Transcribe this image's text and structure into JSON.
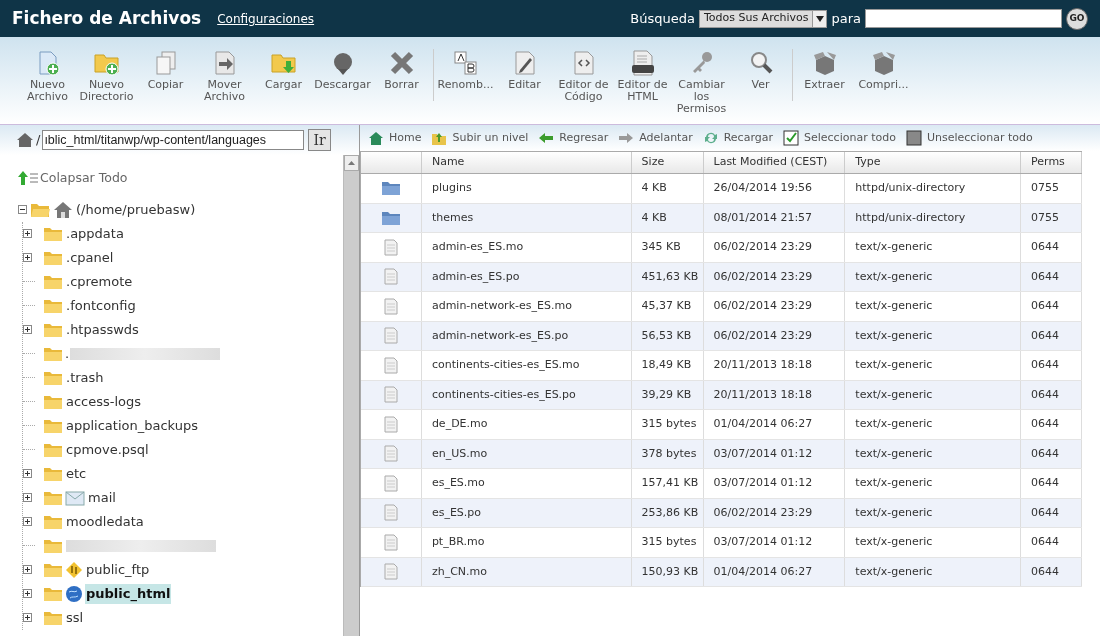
{
  "header": {
    "title": "Fichero de Archivos",
    "settings_link": "Configuraciones",
    "search_label": "Búsqueda",
    "search_scope": "Todos Sus Archivos",
    "for_label": "para",
    "go": "GO"
  },
  "toolbar": [
    [
      "Nuevo Archivo",
      "Nuevo Directorio",
      "Copiar",
      "Mover Archivo",
      "Cargar",
      "Descargar",
      "Borrar"
    ],
    [
      "Renomb...",
      "Editar",
      "Editor de Código",
      "Editor de HTML",
      "Cambiar los Permisos",
      "Ver"
    ],
    [
      "Extraer",
      "Compri..."
    ]
  ],
  "path": {
    "value": "ıblic_html/titanwp/wp-content/languages",
    "prefix": "/",
    "button": "Ir"
  },
  "collapse_all": "Colapsar Todo",
  "tree": {
    "label": "(/home/pruebasw)",
    "expanded": true,
    "children": [
      {
        "label": ".appdata",
        "kind": "folder",
        "expandable": true,
        "selected": false
      },
      {
        "label": ".cpanel",
        "kind": "folder",
        "expandable": true,
        "selected": false
      },
      {
        "label": ".cpremote",
        "kind": "folder",
        "expandable": false,
        "selected": false
      },
      {
        "label": ".fontconfig",
        "kind": "folder",
        "expandable": false,
        "selected": false
      },
      {
        "label": ".htpasswds",
        "kind": "folder",
        "expandable": true,
        "selected": false
      },
      {
        "label": ".",
        "kind": "blurred",
        "expandable": false,
        "selected": false
      },
      {
        "label": ".trash",
        "kind": "folder",
        "expandable": false,
        "selected": false
      },
      {
        "label": "access-logs",
        "kind": "folder",
        "expandable": false,
        "selected": false
      },
      {
        "label": "application_backups",
        "kind": "folder",
        "expandable": false,
        "selected": false
      },
      {
        "label": "cpmove.psql",
        "kind": "folder",
        "expandable": false,
        "selected": false
      },
      {
        "label": "etc",
        "kind": "folder",
        "expandable": true,
        "selected": false
      },
      {
        "label": "mail",
        "kind": "mail",
        "expandable": true,
        "selected": false
      },
      {
        "label": "moodledata",
        "kind": "folder",
        "expandable": true,
        "selected": false
      },
      {
        "kind": "blurred",
        "expandable": false,
        "selected": false
      },
      {
        "label": "public_ftp",
        "kind": "ftp",
        "expandable": true,
        "selected": false
      },
      {
        "label": "public_html",
        "kind": "web",
        "expandable": true,
        "selected": true
      },
      {
        "label": "ssl",
        "kind": "folder",
        "expandable": true,
        "selected": false
      }
    ]
  },
  "actions": [
    "Home",
    "Subir un nivel",
    "Regresar",
    "Adelantar",
    "Recargar",
    "Seleccionar todo",
    "Unseleccionar todo"
  ],
  "table": {
    "columns": [
      "Name",
      "Size",
      "Last Modified (CEST)",
      "Type",
      "Perms"
    ],
    "rows": [
      {
        "kind": "folder",
        "cells": [
          "plugins",
          "4 KB",
          "26/04/2014 19:56",
          "httpd/unix-directory",
          "0755"
        ]
      },
      {
        "kind": "folder",
        "cells": [
          "themes",
          "4 KB",
          "08/01/2014 21:57",
          "httpd/unix-directory",
          "0755"
        ]
      },
      {
        "kind": "file",
        "cells": [
          "admin-es_ES.mo",
          "345 KB",
          "06/02/2014 23:29",
          "text/x-generic",
          "0644"
        ]
      },
      {
        "kind": "file",
        "cells": [
          "admin-es_ES.po",
          "451,63 KB",
          "06/02/2014 23:29",
          "text/x-generic",
          "0644"
        ]
      },
      {
        "kind": "file",
        "cells": [
          "admin-network-es_ES.mo",
          "45,37 KB",
          "06/02/2014 23:29",
          "text/x-generic",
          "0644"
        ]
      },
      {
        "kind": "file",
        "cells": [
          "admin-network-es_ES.po",
          "56,53 KB",
          "06/02/2014 23:29",
          "text/x-generic",
          "0644"
        ]
      },
      {
        "kind": "file",
        "cells": [
          "continents-cities-es_ES.mo",
          "18,49 KB",
          "20/11/2013 18:18",
          "text/x-generic",
          "0644"
        ]
      },
      {
        "kind": "file",
        "cells": [
          "continents-cities-es_ES.po",
          "39,29 KB",
          "20/11/2013 18:18",
          "text/x-generic",
          "0644"
        ]
      },
      {
        "kind": "file",
        "cells": [
          "de_DE.mo",
          "315 bytes",
          "01/04/2014 06:27",
          "text/x-generic",
          "0644"
        ]
      },
      {
        "kind": "file",
        "cells": [
          "en_US.mo",
          "378 bytes",
          "03/07/2014 01:12",
          "text/x-generic",
          "0644"
        ]
      },
      {
        "kind": "file",
        "cells": [
          "es_ES.mo",
          "157,41 KB",
          "03/07/2014 01:12",
          "text/x-generic",
          "0644"
        ]
      },
      {
        "kind": "file",
        "cells": [
          "es_ES.po",
          "253,86 KB",
          "06/02/2014 23:29",
          "text/x-generic",
          "0644"
        ]
      },
      {
        "kind": "file",
        "cells": [
          "pt_BR.mo",
          "315 bytes",
          "03/07/2014 01:12",
          "text/x-generic",
          "0644"
        ]
      },
      {
        "kind": "file",
        "cells": [
          "zh_CN.mo",
          "150,93 KB",
          "01/04/2014 06:27",
          "text/x-generic",
          "0644"
        ]
      }
    ]
  }
}
